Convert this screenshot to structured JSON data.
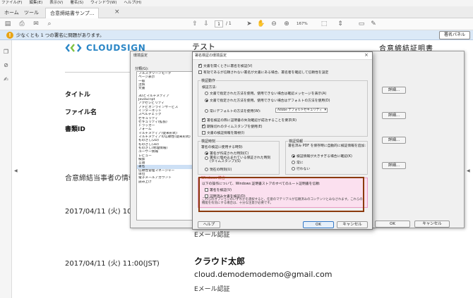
{
  "menubar": {
    "items": [
      "ファイル(F)",
      "編集(E)",
      "表示(V)",
      "署名(S)",
      "ウィンドウ(W)",
      "ヘルプ(H)"
    ]
  },
  "tabs": {
    "home": "ホーム",
    "tools": "ツール",
    "document": "合意締結書サンプ..."
  },
  "toolbar": {
    "page_current": "1",
    "page_total": "/ 1",
    "zoom": "167%"
  },
  "signature_bar": {
    "message": "少なくとも 1 つの署名に問題があります。",
    "panel_button": "署名パネル",
    "icon": "warning-icon"
  },
  "document": {
    "logo_text": "CLOUDSIGN",
    "title": "テスト",
    "title_right": "合意締結証明書",
    "label_title": "タイトル",
    "label_filename": "ファイル名",
    "label_docid": "書類ID",
    "section_title": "合意締結当事者の情報",
    "entry1_datetime": "2017/04/11 (火) 10:",
    "entry1_auth": "Eメール認証",
    "entry2_datetime": "2017/04/11 (火) 11:00(JST)",
    "entry2_name": "クラウド太郎",
    "entry2_email": "cloud.demodemodemo@gmail.com",
    "entry2_auth": "Eメール認証"
  },
  "preferences_dialog": {
    "title": "環境設定",
    "category_label": "分類(G):",
    "categories": [
      "フルスクリーンモード",
      "ページ表示",
      "一般",
      "注釈",
      "文書",
      "",
      "3Dとマルチメディア",
      "JavaScript",
      "アクセシビリティ",
      "アドビオンラインサービス",
      "インターネット",
      "スペルチェック",
      "セキュリティ",
      "セキュリティ(拡張)",
      "トラッカー",
      "フォーム",
      "マルチメディア(従来形式)",
      "マルチメディアの信頼性(従来形式)",
      "ものさし(2D)",
      "ものさし(3D)",
      "ものさし(地理情報)",
      "ユーザー情報",
      "レビュー",
      "検索",
      "言語",
      "署名",
      "信頼性管理マネージャー",
      "単位",
      "電子メールアカウント",
      "読み上げ"
    ],
    "selected_category": "署名",
    "detail_button": "詳細...",
    "ok_button": "OK",
    "cancel_button": "キャンセル"
  },
  "verification_dialog": {
    "title": "署名検証の環境設定",
    "close": "×",
    "opt_verify_on_open": "文書を開くときに署名を検証(V)",
    "opt_hide_unverified": "有効であるが信頼されない署名が文書にある場合、署名者を確認して信頼性を設定",
    "group_behavior": "検証動作",
    "verify_method_label": "検証方法:",
    "radio_default_method": "文書で指定された方法を使用。使用できない場合は確認メッセージを表示(A)",
    "radio_doc_method": "文書で指定された方法を使用。使用できない場合はデフォルトの方法を使用(D)",
    "radio_always_default": "常にデフォルトの方法を使用(W):",
    "default_method_value": "Adobe デフォルトセキュリティ",
    "opt_require_revocation": "署名検証の際に証明書の失効確認が成功することを要求(R)",
    "opt_ignore_expired": "期限切れのタイムスタンプを使用(E)",
    "opt_ignore_docmdp": "文書の検証情報を無視(I)",
    "group_verify_time": "検証時刻",
    "verify_time_label": "署名の検証に使用する時刻:",
    "radio_sign_time": "署名が作成された時刻(C)",
    "radio_timestamp": "署名に埋め込まれている保証された時刻 (タイムスタンプ)(S)",
    "radio_current": "現在の時刻(U)",
    "group_verify_info": "検証情報",
    "verify_info_label": "署名済み PDF を保存時に自動的に検証情報を追加:",
    "radio_large_info": "検証情報が大きすぎる場合に確認(K)",
    "radio_always": "常に",
    "radio_never": "行わない",
    "group_windows": "Windows 統合",
    "windows_desc": "以下の操作について、Windows 証明書ストアのすべてのルート証明書を信頼:",
    "opt_validate_sigs": "署名を検証(V)",
    "opt_validate_certified": "証明済み文書を検証(D)",
    "windows_note": "これらのオプションのいずれかを選択すると、任意のマテリアルが信頼済みのコンテンツとみなされます。これらの機能を有効にする場合は、十分な注意が必要です。",
    "help_button": "ヘルプ",
    "ok_button": "OK",
    "cancel_button": "キャンセル"
  }
}
